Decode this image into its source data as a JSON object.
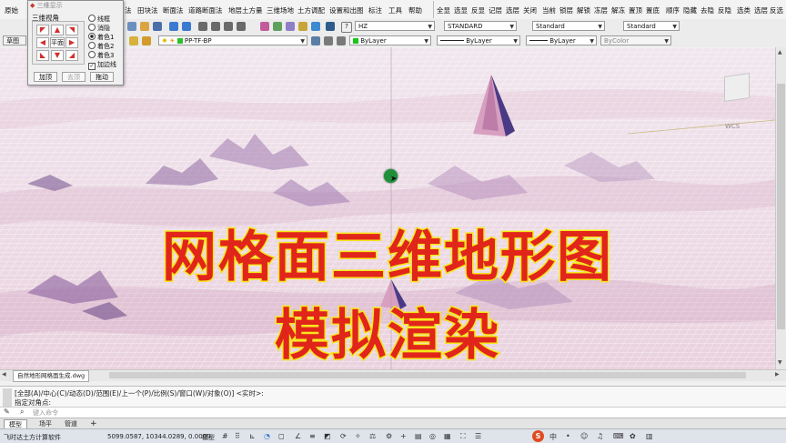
{
  "panel": {
    "title": "三维显示",
    "view_label": "三维视角",
    "center_label": "平面",
    "modes": [
      "线框",
      "消隐",
      "着色1",
      "着色2",
      "着色3"
    ],
    "selected_mode": "着色1",
    "checkbox_label": "加边线",
    "buttons": [
      "加顶",
      "去顶",
      "拖动"
    ]
  },
  "menubar": {
    "items": [
      "原始",
      "法",
      "田块法",
      "断面法",
      "道路断面法",
      "地层土方量",
      "三维场地",
      "土方调配",
      "设置和出图",
      "标注",
      "工具",
      "帮助"
    ],
    "right_items": [
      "全显",
      "选显",
      "反显",
      "记层",
      "选层",
      "关闭",
      "当前",
      "锁层",
      "解锁",
      "冻层",
      "解冻",
      "置顶",
      "置底",
      "顺序",
      "隐藏",
      "去隐",
      "反隐",
      "选类",
      "选层",
      "反选"
    ]
  },
  "toolbar2": {
    "combo_hz": "HZ",
    "combo_standard1": "STANDARD",
    "combo_standard2": "Standard",
    "combo_standard3": "Standard"
  },
  "toolbar3": {
    "sketch": "草图",
    "layer": "PP-TF-BP",
    "color": "ByLayer",
    "linetype": "ByLayer",
    "lineweight": "ByLayer",
    "plotstyle": "ByColor"
  },
  "viewport": {
    "wcs": "WCS",
    "file_tab": "自然地形网格面生成.dwg",
    "title_line1": "网格面三维地形图",
    "title_line2": "模拟渲染"
  },
  "command": {
    "history": "[全部(A)/中心(C)/动态(D)/范围(E)/上一个(P)/比例(S)/窗口(W)/对象(O)] <实时>:",
    "prompt": "指定对角点:",
    "input_placeholder": "键入命令"
  },
  "layout_tabs": [
    "模型",
    "场平",
    "管道"
  ],
  "status": {
    "app": "飞时达土方计算软件",
    "coords": "5099.0587, 10344.0289, 0.0000",
    "space": "模型"
  },
  "colors": {
    "terrain_fill": "#f4e9f1",
    "terrain_dark": "#7a5a8e",
    "caption_red": "#e1251b",
    "caption_outline": "#f6e71c"
  }
}
